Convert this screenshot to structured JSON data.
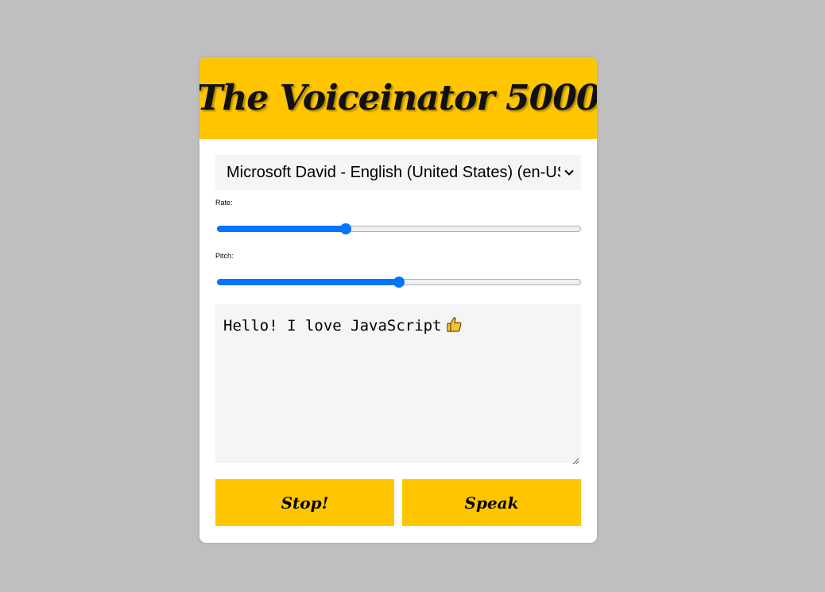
{
  "app": {
    "title": "The Voiceinator 5000"
  },
  "voice_select": {
    "selected": "Microsoft David - English (United States) (en-US)"
  },
  "controls": {
    "rate": {
      "label": "Rate:",
      "value": 0.35
    },
    "pitch": {
      "label": "Pitch:",
      "value": 0.5
    }
  },
  "message": {
    "text": "Hello! I love JavaScript"
  },
  "buttons": {
    "stop_label": "Stop!",
    "speak_label": "Speak"
  },
  "icons": {
    "select_arrow": "chevron-down-icon",
    "emoji": "thumbs-up-icon",
    "resize": "resize-handle-icon"
  },
  "colors": {
    "accent": "#ffc600",
    "slider": "#0075ff",
    "background": "#bfbfbf",
    "field": "#f5f5f5"
  }
}
